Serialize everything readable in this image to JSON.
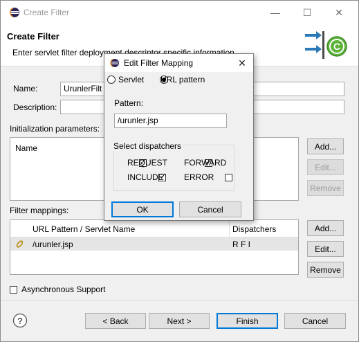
{
  "window": {
    "title": "Create Filter",
    "minimize_glyph": "—",
    "maximize_glyph": "☐",
    "close_glyph": "✕"
  },
  "banner": {
    "heading": "Create Filter",
    "description": "Enter servlet filter deployment descriptor specific information"
  },
  "form": {
    "name_label": "Name:",
    "name_value": "UrunlerFilt",
    "description_label": "Description:",
    "description_value": "",
    "init_params_label": "Initialization parameters:",
    "init_params_header": "Name",
    "init_buttons": {
      "add": "Add...",
      "edit": "Edit...",
      "remove": "Remove"
    },
    "filter_mappings_label": "Filter mappings:",
    "mappings_headers": {
      "pattern": "URL Pattern / Servlet Name",
      "dispatchers": "Dispatchers"
    },
    "mappings_rows": [
      {
        "pattern": "/urunler.jsp",
        "dispatchers": "R F I"
      }
    ],
    "mapping_buttons": {
      "add": "Add...",
      "edit": "Edit...",
      "remove": "Remove"
    },
    "async_label": "Asynchronous Support",
    "async_checked": false
  },
  "footer": {
    "help_glyph": "?",
    "back": "< Back",
    "next": "Next >",
    "finish": "Finish",
    "cancel": "Cancel"
  },
  "dialog": {
    "title": "Edit Filter Mapping",
    "close_glyph": "✕",
    "radio_servlet": "Servlet",
    "radio_url": "URL pattern",
    "selected_radio": "URL pattern",
    "pattern_label": "Pattern:",
    "pattern_value": "/urunler.jsp",
    "dispatchers_label": "Select dispatchers",
    "dispatchers": {
      "request": {
        "label": "REQUEST",
        "checked": true
      },
      "forward": {
        "label": "FORWARD",
        "checked": true
      },
      "include": {
        "label": "INCLUDE",
        "checked": true
      },
      "error": {
        "label": "ERROR",
        "checked": false
      }
    },
    "ok": "OK",
    "cancel": "Cancel"
  },
  "colors": {
    "accent": "#0078d7",
    "eclipse_purple": "#2c2255",
    "eclipse_orange": "#f7941e",
    "wizard_arrow": "#2a7ab8",
    "wizard_green": "#5db33a",
    "selected_row": "#e5e5e5"
  },
  "icons": [
    "eclipse-icon",
    "wizard-filter-icon",
    "mapping-row-icon",
    "help-icon"
  ]
}
